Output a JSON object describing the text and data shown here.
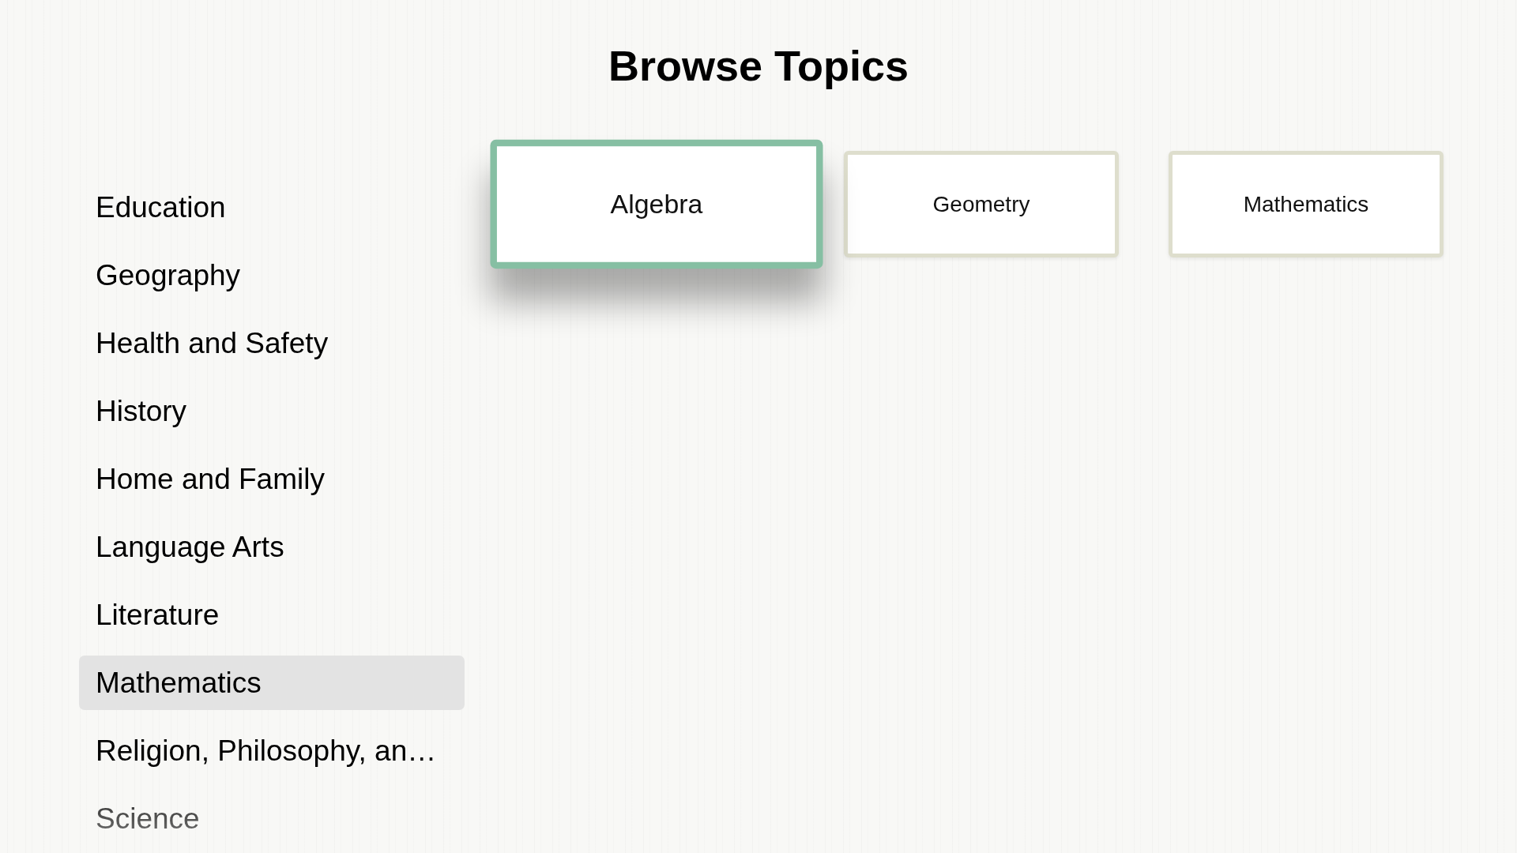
{
  "title": "Browse Topics",
  "sidebar": {
    "items": [
      {
        "label": "Education",
        "selected": false
      },
      {
        "label": "Geography",
        "selected": false
      },
      {
        "label": "Health and Safety",
        "selected": false
      },
      {
        "label": "History",
        "selected": false
      },
      {
        "label": "Home and Family",
        "selected": false
      },
      {
        "label": "Language Arts",
        "selected": false
      },
      {
        "label": "Literature",
        "selected": false
      },
      {
        "label": "Mathematics",
        "selected": true
      },
      {
        "label": "Religion, Philosophy, an…",
        "selected": false
      },
      {
        "label": "Science",
        "selected": false
      }
    ]
  },
  "topics": [
    {
      "label": "Algebra",
      "selected": true
    },
    {
      "label": "Geometry",
      "selected": false
    },
    {
      "label": "Mathematics",
      "selected": false
    }
  ]
}
